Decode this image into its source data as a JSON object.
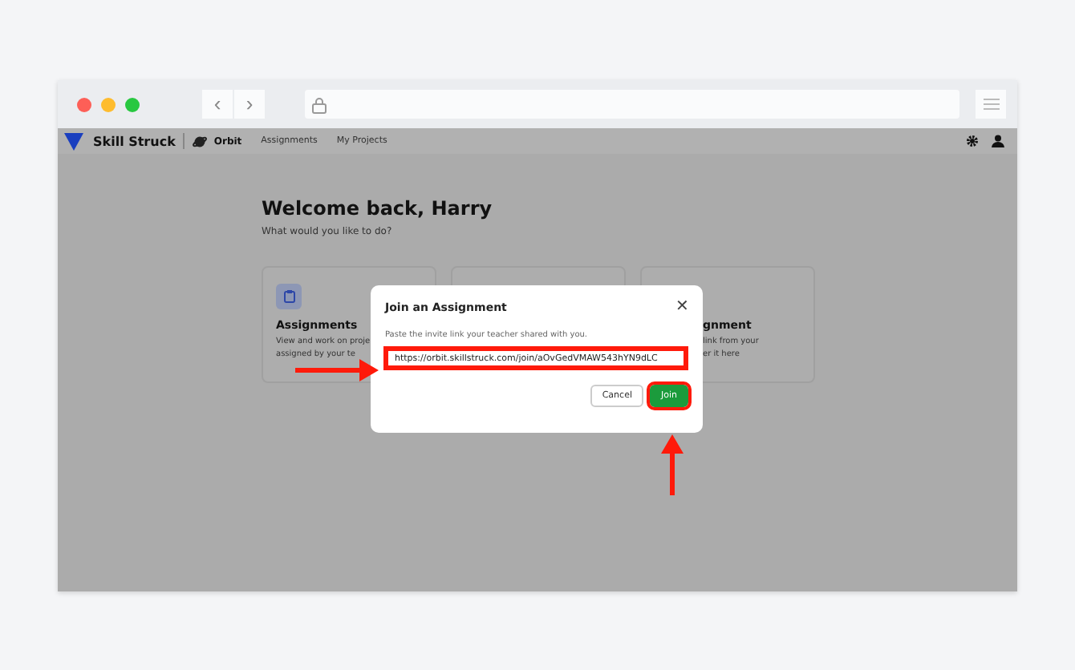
{
  "browser": {
    "back": "‹",
    "forward": "›"
  },
  "nav": {
    "brand": "Skill Struck",
    "product": "Orbit",
    "links": [
      {
        "label": "Assignments",
        "selected": false
      },
      {
        "label": "My Projects",
        "selected": false
      }
    ]
  },
  "welcome": {
    "title": "Welcome back, Harry",
    "subtitle": "What would you like to do?"
  },
  "cards": [
    {
      "kind": "icon",
      "title": "Assignments",
      "lines": [
        "View and work on proje",
        "assigned by your te"
      ]
    },
    {
      "kind": "hidden"
    },
    {
      "kind": "text",
      "title": "gnment",
      "lines": [
        "link from your",
        "er it here"
      ]
    }
  ],
  "modal": {
    "title": "Join an Assignment",
    "close": "✕",
    "hint": "Paste the invite link your teacher shared with you.",
    "value": "https://orbit.skillstruck.com/join/aOvGedVMAW543hYN9dLC",
    "highlighted": true,
    "buttons": [
      {
        "label": "Cancel",
        "kind": "secondary",
        "highlighted": false
      },
      {
        "label": "Join",
        "kind": "primary",
        "highlighted": true
      }
    ]
  },
  "annotations": [
    {
      "kind": "rightarrow"
    },
    {
      "kind": "uparrow"
    }
  ]
}
